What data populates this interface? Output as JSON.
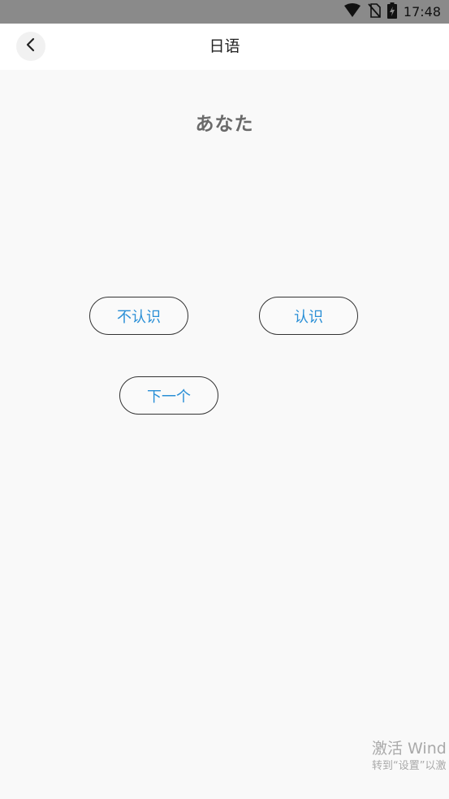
{
  "status_bar": {
    "time": "17:48",
    "icons": [
      "wifi-icon",
      "no-sim-icon",
      "battery-charging-icon"
    ]
  },
  "nav": {
    "title": "日语",
    "back_icon": "chevron-left-icon"
  },
  "card": {
    "word": "あなた"
  },
  "buttons": {
    "unknown": "不认识",
    "known": "认识",
    "next": "下一个"
  },
  "watermark": {
    "title": "激活 Wind",
    "subtitle": "转到“设置”以激"
  },
  "colors": {
    "accent": "#2a8fd6",
    "status_bar": "#8a8a8a",
    "background": "#f9f9f9",
    "word_text": "#6a6a6a"
  }
}
